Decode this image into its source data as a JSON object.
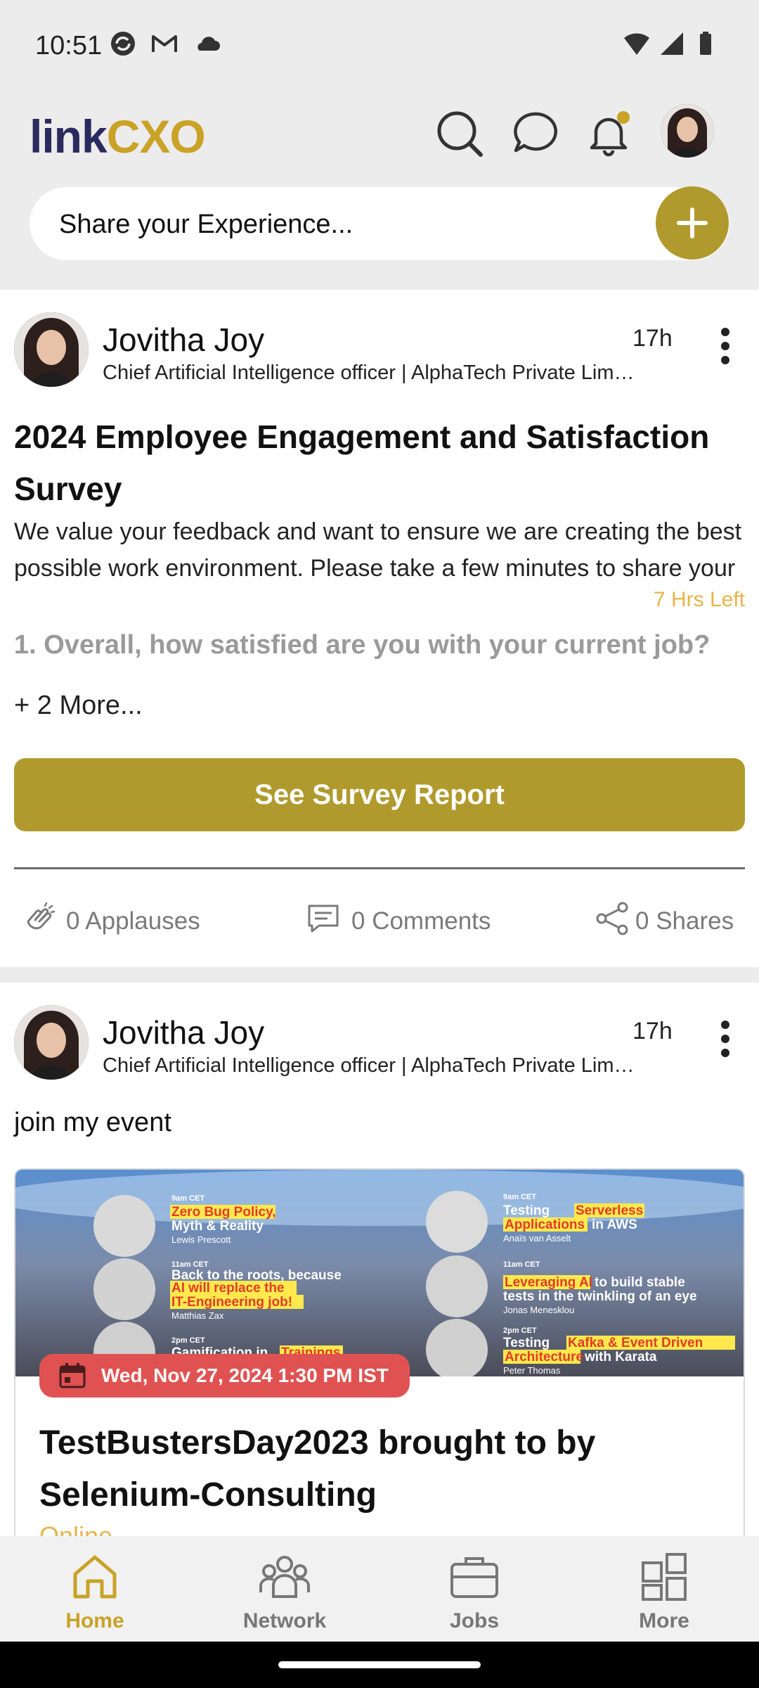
{
  "status_bar": {
    "time": "10:51"
  },
  "header": {
    "logo_part1": "link",
    "logo_part2": "CXO",
    "share_placeholder": "Share your Experience..."
  },
  "posts": [
    {
      "author": "Jovitha Joy",
      "subtitle": "Chief Artificial Intelligence officer | AlphaTech Private Limited",
      "time": "17h",
      "title": "2024 Employee Engagement and Satisfaction Survey",
      "description": "We value your feedback and want to ensure we are creating the best possible work environment. Please take a few minutes to share your thoughts.",
      "time_left": "7 Hrs Left",
      "question": "1. Overall, how satisfied are you with your current job?",
      "more": "+ 2 More...",
      "button": "See Survey Report",
      "applauses": "0 Applauses",
      "comments": "0 Comments",
      "shares": "0 Shares"
    },
    {
      "author": "Jovitha Joy",
      "subtitle": "Chief Artificial Intelligence officer | AlphaTech Private Limited",
      "time": "17h",
      "text": "join my event",
      "event_date": "Wed, Nov 27, 2024 1:30 PM IST",
      "event_title": "TestBustersDay2023 brought to by Selenium-Consulting",
      "event_mode": "Online",
      "banner": {
        "s1_time": "9am CET",
        "s1_title_a": "Zero Bug Policy,",
        "s1_title_b": "Myth & Reality",
        "s1_speaker": "Lewis Prescott",
        "s2_time": "11am CET",
        "s2_title_a": "Back to the roots, because",
        "s2_title_b": "AI will replace the",
        "s2_title_c": "IT-Engineering job!",
        "s2_speaker": "Matthias Zax",
        "s3_time": "2pm CET",
        "s3_title_a": "Gamification in",
        "s3_title_b": "Trainings",
        "s4_time": "9am CET",
        "s4_title_a": "Testing",
        "s4_title_b": "Serverless",
        "s4_title_c": "Applications",
        "s4_title_d": "in AWS",
        "s4_speaker": "Anaïs van Asselt",
        "s5_time": "11am CET",
        "s5_title_a": "Leveraging AI",
        "s5_title_b": "to build stable",
        "s5_title_c": "tests in the twinkling of an eye",
        "s5_speaker": "Jonas Menesklou",
        "s6_time": "2pm CET",
        "s6_title_a": "Testing",
        "s6_title_b": "Kafka & Event Driven",
        "s6_title_c": "Architecture",
        "s6_title_d": "with Karata",
        "s6_speaker": "Peter Thomas"
      }
    }
  ],
  "bottom_nav": {
    "items": [
      {
        "label": "Home",
        "icon": "home-icon",
        "active": true
      },
      {
        "label": "Network",
        "icon": "network-icon",
        "active": false
      },
      {
        "label": "Jobs",
        "icon": "briefcase-icon",
        "active": false
      },
      {
        "label": "More",
        "icon": "grid-icon",
        "active": false
      }
    ]
  },
  "colors": {
    "accent_olive": "#b09a2e",
    "accent_gold": "#c9a227",
    "time_left": "#e8b44a",
    "date_pill": "#e05252",
    "logo_navy": "#2a2a5e"
  }
}
